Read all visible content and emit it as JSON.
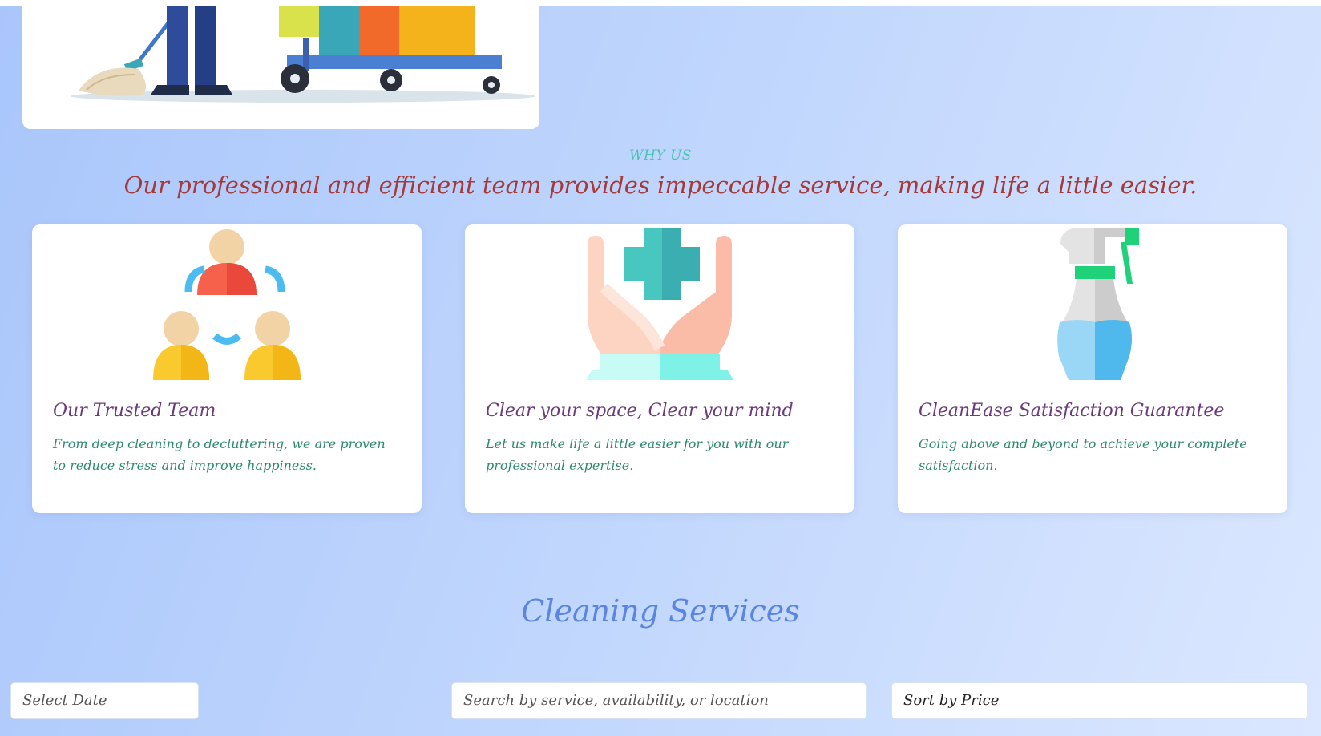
{
  "why_us": {
    "label": "WHY US",
    "title": "Our professional and efficient team provides impeccable service, making life a little easier."
  },
  "features": [
    {
      "title": "Our Trusted Team",
      "description": "From deep cleaning to decluttering, we are proven to reduce stress and improve happiness.",
      "icon": "team-icon"
    },
    {
      "title": "Clear your space, Clear your mind",
      "description": "Let us make life a little easier for you with our professional expertise.",
      "icon": "care-hands-icon"
    },
    {
      "title": "CleanEase Satisfaction Guarantee",
      "description": "Going above and beyond to achieve your complete satisfaction.",
      "icon": "spray-bottle-icon"
    }
  ],
  "services": {
    "title": "Cleaning Services",
    "date_placeholder": "Select Date",
    "search_placeholder": "Search by service, availability, or location",
    "sort_label": "Sort by Price"
  },
  "colors": {
    "accent_teal": "#49c2b4",
    "heading_red": "#a53a3a",
    "card_title_purple": "#6b3a78",
    "card_text_green": "#2d8a6e",
    "services_blue": "#5b86e0"
  }
}
